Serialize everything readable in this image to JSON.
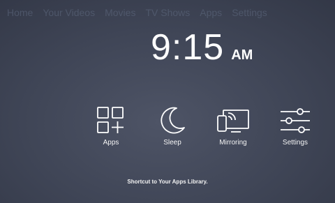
{
  "nav": {
    "items": [
      "Home",
      "Your Videos",
      "Movies",
      "TV Shows",
      "Apps",
      "Settings"
    ]
  },
  "clock": {
    "time": "9:15",
    "ampm": "AM"
  },
  "actions": [
    {
      "label": "Apps",
      "icon": "apps-grid-icon"
    },
    {
      "label": "Sleep",
      "icon": "moon-icon"
    },
    {
      "label": "Mirroring",
      "icon": "mirroring-icon"
    },
    {
      "label": "Settings",
      "icon": "sliders-icon"
    }
  ],
  "hint": "Shortcut to Your Apps Library.",
  "colors": {
    "background": "#3f4556",
    "text": "#ffffff",
    "nav_faded": "#5f6a80"
  }
}
